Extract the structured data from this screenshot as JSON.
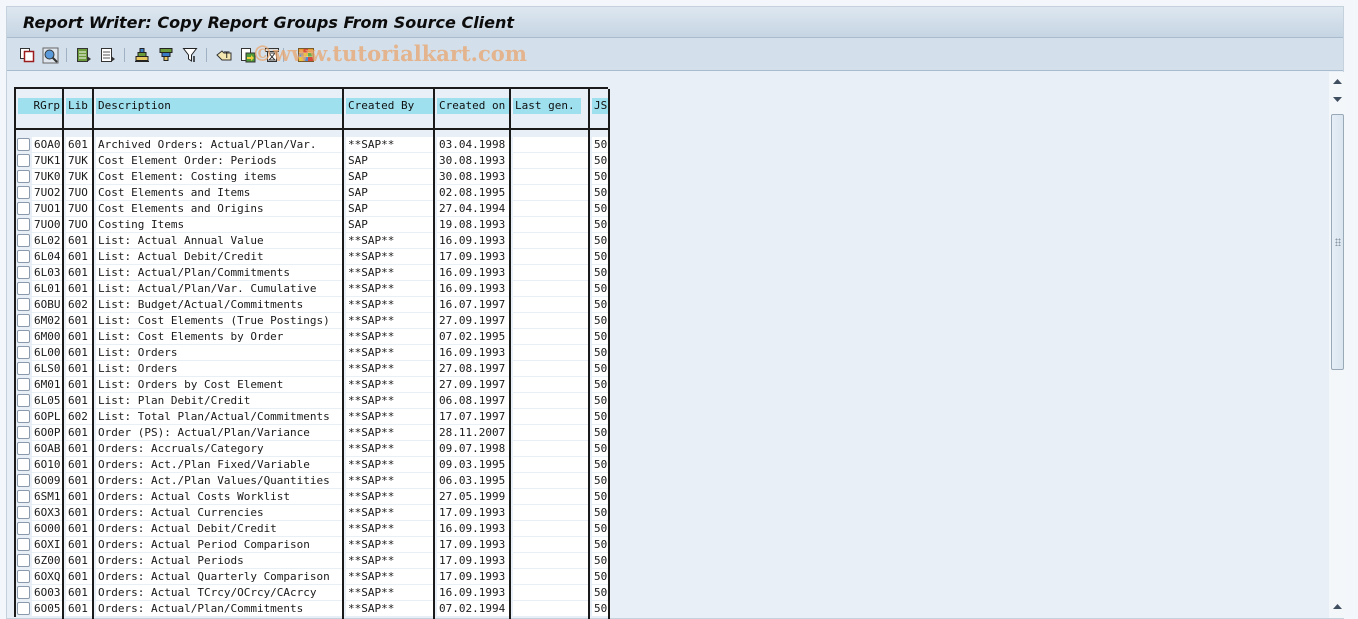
{
  "window": {
    "title": "Report Writer: Copy Report Groups From Source Client",
    "watermark": "©www.tutorialkart.com"
  },
  "toolbar": {
    "buttons": [
      {
        "name": "select-all",
        "icon": "select-all-icon"
      },
      {
        "name": "details",
        "icon": "details-magnifier-icon"
      },
      {
        "name": "choose-layout",
        "icon": "choose-layout-icon"
      },
      {
        "name": "save-layout",
        "icon": "save-layout-icon"
      },
      {
        "name": "sort-ascending",
        "icon": "sort-ascending-icon"
      },
      {
        "name": "sort-descending",
        "icon": "sort-descending-icon"
      },
      {
        "name": "filter",
        "icon": "filter-icon"
      },
      {
        "name": "total",
        "icon": "total-icon"
      },
      {
        "name": "export",
        "icon": "export-icon"
      },
      {
        "name": "print-preview",
        "icon": "print-preview-icon"
      },
      {
        "name": "change-layout",
        "icon": "change-layout-grid-icon"
      }
    ]
  },
  "table": {
    "columns": [
      {
        "key": "rgrp",
        "label": "RGrp"
      },
      {
        "key": "lib",
        "label": "Lib"
      },
      {
        "key": "description",
        "label": "Description"
      },
      {
        "key": "created_by",
        "label": "Created By"
      },
      {
        "key": "created_on",
        "label": "Created on"
      },
      {
        "key": "last_gen",
        "label": "Last gen."
      },
      {
        "key": "js",
        "label": "JS"
      }
    ],
    "rows": [
      {
        "rgrp": "6OA0",
        "lib": "601",
        "description": "Archived Orders: Actual/Plan/Var.",
        "created_by": "**SAP**",
        "created_on": "03.04.1998",
        "last_gen": "",
        "js": "50"
      },
      {
        "rgrp": "7UK1",
        "lib": "7UK",
        "description": "Cost Element Order: Periods",
        "created_by": "SAP",
        "created_on": "30.08.1993",
        "last_gen": "",
        "js": "50"
      },
      {
        "rgrp": "7UK0",
        "lib": "7UK",
        "description": "Cost Element: Costing items",
        "created_by": "SAP",
        "created_on": "30.08.1993",
        "last_gen": "",
        "js": "50"
      },
      {
        "rgrp": "7UO2",
        "lib": "7UO",
        "description": "Cost Elements and Items",
        "created_by": "SAP",
        "created_on": "02.08.1995",
        "last_gen": "",
        "js": "50"
      },
      {
        "rgrp": "7UO1",
        "lib": "7UO",
        "description": "Cost Elements and Origins",
        "created_by": "SAP",
        "created_on": "27.04.1994",
        "last_gen": "",
        "js": "50"
      },
      {
        "rgrp": "7UO0",
        "lib": "7UO",
        "description": "Costing Items",
        "created_by": "SAP",
        "created_on": "19.08.1993",
        "last_gen": "",
        "js": "50"
      },
      {
        "rgrp": "6L02",
        "lib": "601",
        "description": "List: Actual Annual Value",
        "created_by": "**SAP**",
        "created_on": "16.09.1993",
        "last_gen": "",
        "js": "50"
      },
      {
        "rgrp": "6L04",
        "lib": "601",
        "description": "List: Actual Debit/Credit",
        "created_by": "**SAP**",
        "created_on": "17.09.1993",
        "last_gen": "",
        "js": "50"
      },
      {
        "rgrp": "6L03",
        "lib": "601",
        "description": "List: Actual/Plan/Commitments",
        "created_by": "**SAP**",
        "created_on": "16.09.1993",
        "last_gen": "",
        "js": "50"
      },
      {
        "rgrp": "6L01",
        "lib": "601",
        "description": "List: Actual/Plan/Var. Cumulative",
        "created_by": "**SAP**",
        "created_on": "16.09.1993",
        "last_gen": "",
        "js": "50"
      },
      {
        "rgrp": "6OBU",
        "lib": "602",
        "description": "List: Budget/Actual/Commitments",
        "created_by": "**SAP**",
        "created_on": "16.07.1997",
        "last_gen": "",
        "js": "50"
      },
      {
        "rgrp": "6M02",
        "lib": "601",
        "description": "List: Cost Elements (True Postings)",
        "created_by": "**SAP**",
        "created_on": "27.09.1997",
        "last_gen": "",
        "js": "50"
      },
      {
        "rgrp": "6M00",
        "lib": "601",
        "description": "List: Cost Elements by Order",
        "created_by": "**SAP**",
        "created_on": "07.02.1995",
        "last_gen": "",
        "js": "50"
      },
      {
        "rgrp": "6L00",
        "lib": "601",
        "description": "List: Orders",
        "created_by": "**SAP**",
        "created_on": "16.09.1993",
        "last_gen": "",
        "js": "50"
      },
      {
        "rgrp": "6LS0",
        "lib": "601",
        "description": "List: Orders",
        "created_by": "**SAP**",
        "created_on": "27.08.1997",
        "last_gen": "",
        "js": "50"
      },
      {
        "rgrp": "6M01",
        "lib": "601",
        "description": "List: Orders by Cost Element",
        "created_by": "**SAP**",
        "created_on": "27.09.1997",
        "last_gen": "",
        "js": "50"
      },
      {
        "rgrp": "6L05",
        "lib": "601",
        "description": "List: Plan Debit/Credit",
        "created_by": "**SAP**",
        "created_on": "06.08.1997",
        "last_gen": "",
        "js": "50"
      },
      {
        "rgrp": "6OPL",
        "lib": "602",
        "description": "List: Total Plan/Actual/Commitments",
        "created_by": "**SAP**",
        "created_on": "17.07.1997",
        "last_gen": "",
        "js": "50"
      },
      {
        "rgrp": "6O0P",
        "lib": "601",
        "description": "Order (PS): Actual/Plan/Variance",
        "created_by": "**SAP**",
        "created_on": "28.11.2007",
        "last_gen": "",
        "js": "50"
      },
      {
        "rgrp": "6OAB",
        "lib": "601",
        "description": "Orders: Accruals/Category",
        "created_by": "**SAP**",
        "created_on": "09.07.1998",
        "last_gen": "",
        "js": "50"
      },
      {
        "rgrp": "6O10",
        "lib": "601",
        "description": "Orders: Act./Plan Fixed/Variable",
        "created_by": "**SAP**",
        "created_on": "09.03.1995",
        "last_gen": "",
        "js": "50"
      },
      {
        "rgrp": "6O09",
        "lib": "601",
        "description": "Orders: Act./Plan Values/Quantities",
        "created_by": "**SAP**",
        "created_on": "06.03.1995",
        "last_gen": "",
        "js": "50"
      },
      {
        "rgrp": "6SM1",
        "lib": "601",
        "description": "Orders: Actual Costs Worklist",
        "created_by": "**SAP**",
        "created_on": "27.05.1999",
        "last_gen": "",
        "js": "50"
      },
      {
        "rgrp": "6OX3",
        "lib": "601",
        "description": "Orders: Actual Currencies",
        "created_by": "**SAP**",
        "created_on": "17.09.1993",
        "last_gen": "",
        "js": "50"
      },
      {
        "rgrp": "6O00",
        "lib": "601",
        "description": "Orders: Actual Debit/Credit",
        "created_by": "**SAP**",
        "created_on": "16.09.1993",
        "last_gen": "",
        "js": "50"
      },
      {
        "rgrp": "6OXI",
        "lib": "601",
        "description": "Orders: Actual Period Comparison",
        "created_by": "**SAP**",
        "created_on": "17.09.1993",
        "last_gen": "",
        "js": "50"
      },
      {
        "rgrp": "6Z00",
        "lib": "601",
        "description": "Orders: Actual Periods",
        "created_by": "**SAP**",
        "created_on": "17.09.1993",
        "last_gen": "",
        "js": "50"
      },
      {
        "rgrp": "6OXQ",
        "lib": "601",
        "description": "Orders: Actual Quarterly Comparison",
        "created_by": "**SAP**",
        "created_on": "17.09.1993",
        "last_gen": "",
        "js": "50"
      },
      {
        "rgrp": "6O03",
        "lib": "601",
        "description": "Orders: Actual TCrcy/OCrcy/CAcrcy",
        "created_by": "**SAP**",
        "created_on": "16.09.1993",
        "last_gen": "",
        "js": "50"
      },
      {
        "rgrp": "6O05",
        "lib": "601",
        "description": "Orders: Actual/Plan/Commitments",
        "created_by": "**SAP**",
        "created_on": "07.02.1994",
        "last_gen": "",
        "js": "50"
      }
    ]
  },
  "colors": {
    "header_cell": "#9fe0ef",
    "title_bar": "#c6d5e3",
    "background": "#e8eff6",
    "watermark": "#e8a66e"
  }
}
